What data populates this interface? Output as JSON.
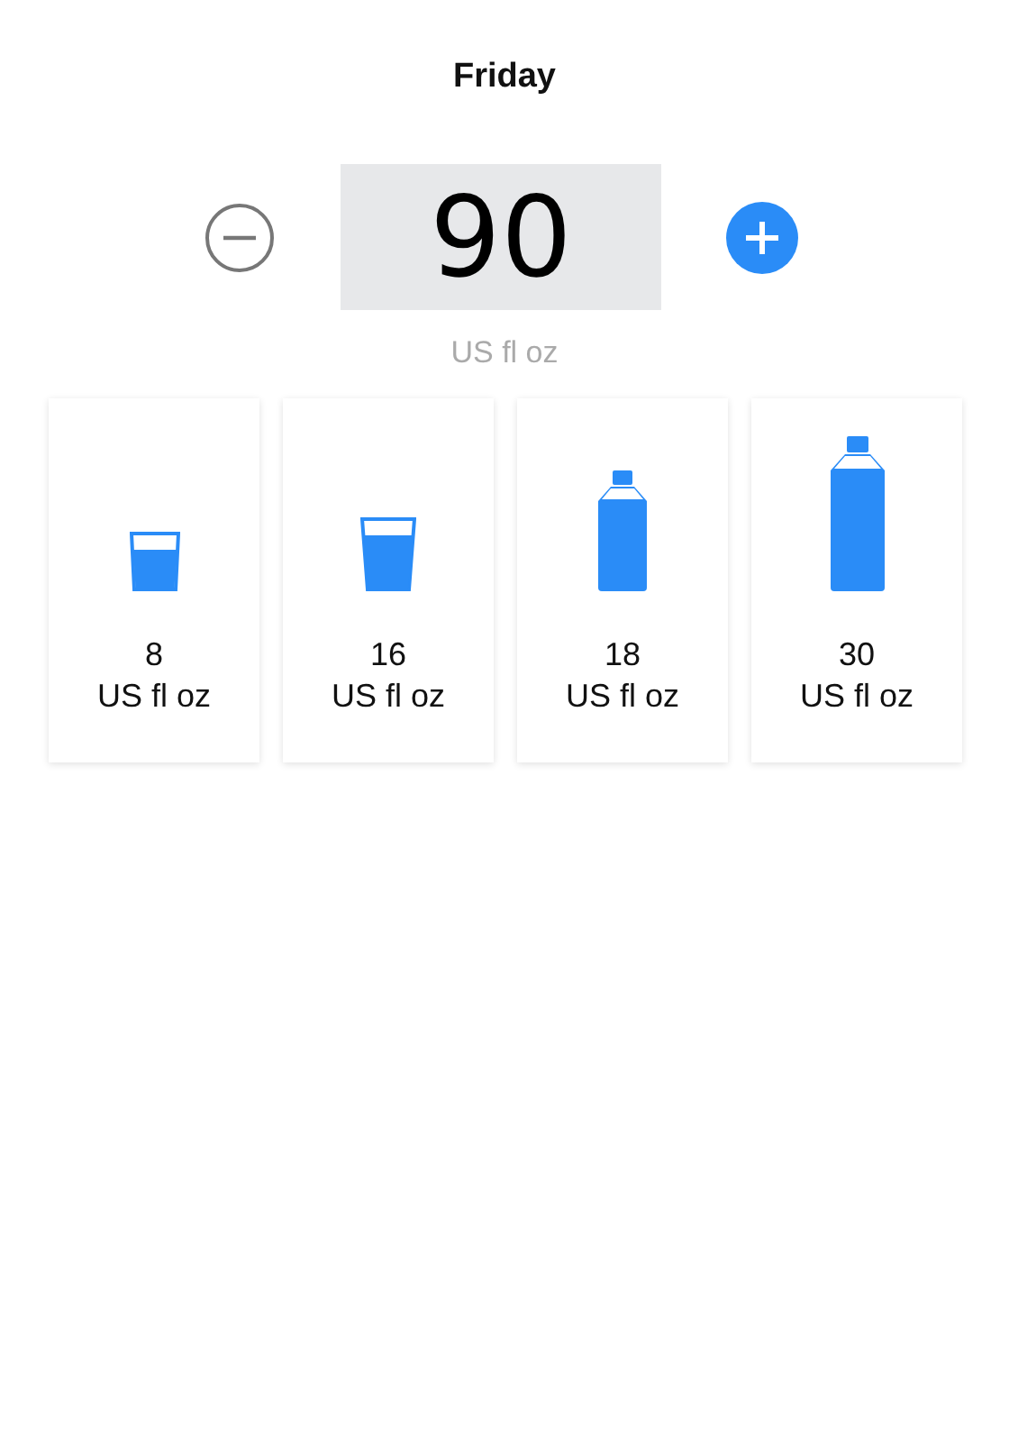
{
  "title": "Friday",
  "stepper": {
    "value": "90",
    "unit": "US fl oz"
  },
  "presets": [
    {
      "kind": "small-glass",
      "amount": "8",
      "unit": "US fl oz"
    },
    {
      "kind": "large-glass",
      "amount": "16",
      "unit": "US fl oz"
    },
    {
      "kind": "small-bottle",
      "amount": "18",
      "unit": "US fl oz"
    },
    {
      "kind": "large-bottle",
      "amount": "30",
      "unit": "US fl oz"
    }
  ]
}
